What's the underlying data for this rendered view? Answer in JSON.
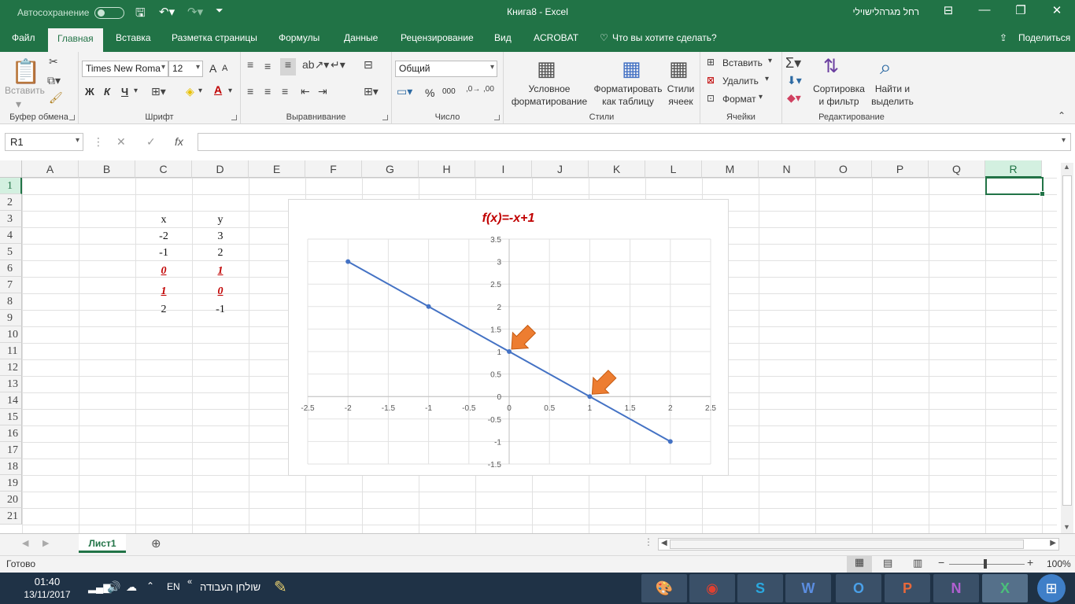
{
  "titlebar": {
    "autosave": "Автосохранение",
    "title": "Книга8  -  Excel",
    "user": "רחל מגרהלישוילי"
  },
  "tabs": [
    "Файл",
    "Главная",
    "Вставка",
    "Разметка страницы",
    "Формулы",
    "Данные",
    "Рецензирование",
    "Вид",
    "ACROBAT",
    "Что вы хотите сделать?"
  ],
  "share": "Поделиться",
  "ribbon": {
    "clipboard": {
      "paste": "Вставить",
      "label": "Буфер обмена"
    },
    "font": {
      "name": "Times New Roma",
      "size": "12",
      "bold": "Ж",
      "italic": "К",
      "underline": "Ч",
      "grow": "A",
      "shrink": "A",
      "label": "Шрифт"
    },
    "alignment": {
      "label": "Выравнивание"
    },
    "number": {
      "format": "Общий",
      "percent": "%",
      "thousands": "000",
      "label": "Число"
    },
    "styles": {
      "conditional1": "Условное",
      "conditional2": "форматирование",
      "table1": "Форматировать",
      "table2": "как таблицу",
      "cell1": "Стили",
      "cell2": "ячеек",
      "label": "Стили"
    },
    "cells": {
      "insert": "Вставить",
      "delete": "Удалить",
      "format": "Формат",
      "label": "Ячейки"
    },
    "editing": {
      "sort1": "Сортировка",
      "sort2": "и фильтр",
      "find1": "Найти и",
      "find2": "выделить",
      "label": "Редактирование"
    }
  },
  "namebox": "R1",
  "fx": "fx",
  "columns": [
    "A",
    "B",
    "C",
    "D",
    "E",
    "F",
    "G",
    "H",
    "I",
    "J",
    "K",
    "L",
    "M",
    "N",
    "O",
    "P",
    "Q",
    "R"
  ],
  "rows": [
    "1",
    "2",
    "3",
    "4",
    "5",
    "6",
    "7",
    "8",
    "9",
    "10",
    "11",
    "12",
    "13",
    "14",
    "15",
    "16",
    "17",
    "18",
    "19",
    "20",
    "21"
  ],
  "table": {
    "header": [
      "x",
      "y"
    ],
    "rows": [
      [
        "-2",
        "3"
      ],
      [
        "-1",
        "2"
      ],
      [
        "0",
        "1"
      ],
      [
        "1",
        "0"
      ],
      [
        "2",
        "-1"
      ]
    ]
  },
  "chart_data": {
    "type": "scatter",
    "title": "f(x)=-x+1",
    "series": [
      {
        "x": [
          -2,
          -1,
          0,
          1,
          2
        ],
        "y": [
          3,
          2,
          1,
          0,
          -1
        ]
      }
    ],
    "xlim": [
      -2.5,
      2.5
    ],
    "ylim": [
      -1.5,
      3.5
    ],
    "xticks": [
      "-2.5",
      "-2",
      "-1.5",
      "-1",
      "-0.5",
      "0",
      "0.5",
      "1",
      "1.5",
      "2",
      "2.5"
    ],
    "yticks": [
      "-1.5",
      "-1",
      "-0.5",
      "0",
      "0.5",
      "1",
      "1.5",
      "2",
      "2.5",
      "3",
      "3.5"
    ],
    "grid": true,
    "annotations": [
      {
        "type": "arrow",
        "x": 0,
        "y": 1
      },
      {
        "type": "arrow",
        "x": 1,
        "y": 0
      }
    ],
    "colors": {
      "line": "#4472c4",
      "title": "#c00000",
      "arrow": "#ed7d31"
    }
  },
  "sheet": {
    "tab": "Лист1"
  },
  "status": {
    "ready": "Готово",
    "zoom": "100%"
  },
  "taskbar": {
    "time": "01:40",
    "date": "13/11/2017",
    "lang": "EN",
    "desktop": "שולחן העבודה"
  },
  "colors": {
    "accent": "#217346"
  }
}
